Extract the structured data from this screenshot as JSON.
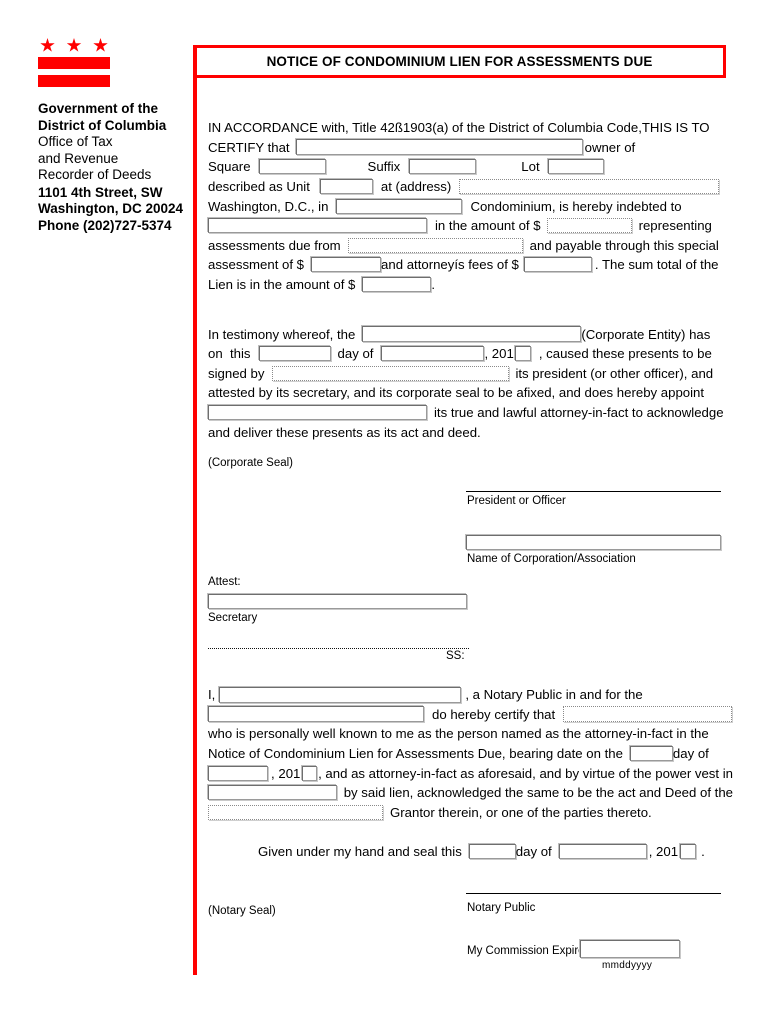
{
  "masthead": {
    "flag_icon": "dc-flag-icon",
    "org_line1": "Government of the",
    "org_line2": "District of Columbia",
    "dept_line1": "Office of Tax",
    "dept_line2": "and Revenue",
    "dept_line3": "Recorder of Deeds",
    "addr_line1": "1101 4th Street, SW",
    "addr_line2": "Washington, DC 20024",
    "addr_line3": "Phone (202)727-5374"
  },
  "title": "NOTICE OF CONDOMINIUM LIEN FOR  ASSESSMENTS DUE",
  "colors": {
    "accent_red": "#ff0000",
    "text": "#000000",
    "field_border": "#8a8a8a"
  },
  "body": {
    "l1": "IN ACCORDANCE with, Title 42ß1903(a) of the District of Columbia Code,THIS IS TO",
    "l2a": "CERTIFY that",
    "l2b": "owner of",
    "l3a": "Square",
    "l3b": "Suffix",
    "l3c": "Lot",
    "l4a": "described as Unit",
    "l4b": "at (address)",
    "l5a": "Washington, D.C., in",
    "l5b": "Condominium, is hereby indebted to",
    "l6a": "in the amount of $",
    "l6b": "representing",
    "l7a": "assessments due from",
    "l7b": "and payable through this special",
    "l8a": "assessment of $",
    "l8b": "and attorneyís fees of $",
    "l8c": ". The sum total of the",
    "l9a": "Lien is in the amount of $",
    "l9b": "."
  },
  "testimony": {
    "t1a": "In testimony whereof, the",
    "t1b": "(Corporate Entity) has",
    "t2a": "on  this",
    "t2b": "day of",
    "t2c": ", 201",
    "t2d": ", caused these presents to be",
    "t3a": "signed by",
    "t3b": "its president (or other officer), and",
    "t4": "attested by its secretary, and its corporate seal to be afixed, and does hereby appoint",
    "t5b": "its true and lawful attorney-in-fact to acknowledge",
    "t6": "and deliver these presents as its act and deed."
  },
  "signatures": {
    "corporate_seal": "(Corporate Seal)",
    "president_or_officer": "President or Officer",
    "name_of_corporation": "Name of Corporation/Association",
    "attest": "Attest:",
    "secretary": "Secretary",
    "ss": "SS:"
  },
  "notary": {
    "n1a": "I,",
    "n1b": ", a Notary Public in and for the",
    "n2a": "do hereby certify that",
    "n3": "who is personally well known to me as the person named as the attorney-in-fact in the",
    "n4a": "Notice of Condominium Lien for Assessments Due, bearing date on the",
    "n4b": "day of",
    "n5a": ", 201",
    "n5b": ", and as attorney-in-fact as aforesaid, and by virtue of the power vest in",
    "n6b": "by said lien, acknowledged the same to be the act and Deed of the",
    "n7b": "Grantor therein, or one of the parties thereto.",
    "given1": "Given under my hand and seal this",
    "given2": "day of",
    "given3": ", 201",
    "given4": ".",
    "notary_seal": "(Notary Seal)",
    "notary_public": "Notary Public",
    "commission_expires": "My Commission Expires:",
    "date_format_hint": "mmddyyyy"
  },
  "fields": {
    "owner_name": "",
    "square": "",
    "suffix": "",
    "lot": "",
    "unit": "",
    "address": "",
    "condominium_name": "",
    "creditor_name": "",
    "amount_owed": "",
    "assessments_due_from": "",
    "special_assessment": "",
    "attorney_fees": "",
    "lien_total": "",
    "corporate_entity": "",
    "day": "",
    "month": "",
    "year_suffix": "",
    "signed_by": "",
    "attorney_in_fact": "",
    "name_of_corporation_value": "",
    "secretary_value": "",
    "notary_name": "",
    "jurisdiction": "",
    "certify_person": "",
    "notary_day": "",
    "notary_month": "",
    "notary_year_suffix": "",
    "lien_power": "",
    "grantor": "",
    "given_day": "",
    "given_month": "",
    "given_year_suffix": "",
    "commission_expires_value": ""
  }
}
